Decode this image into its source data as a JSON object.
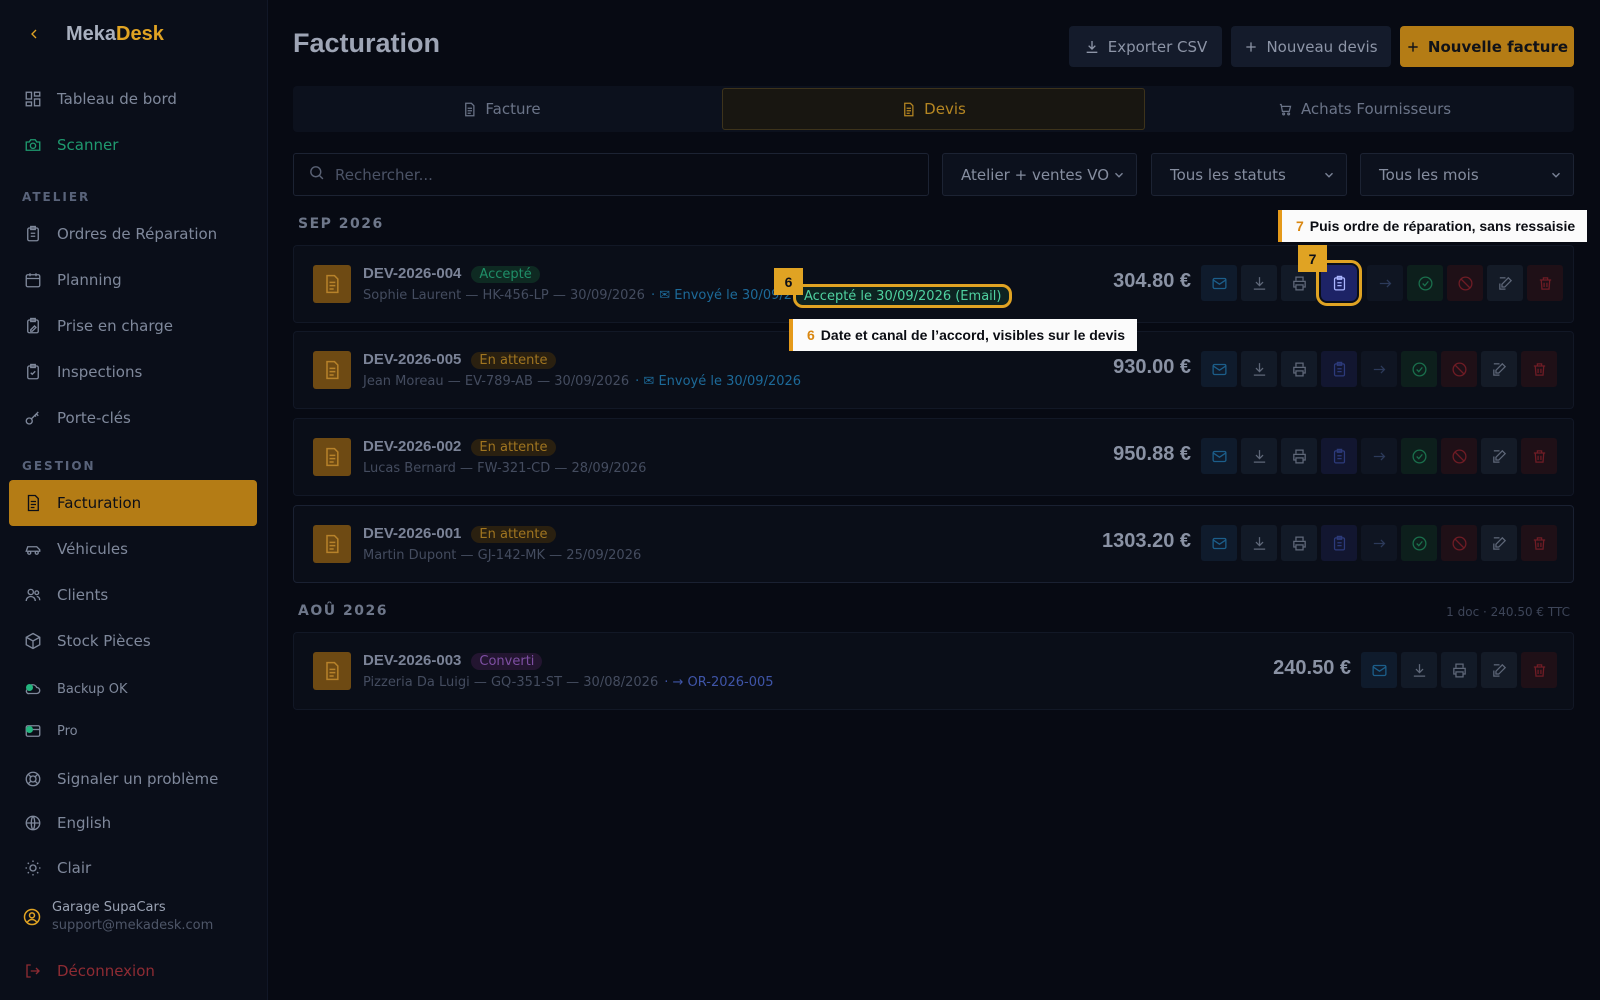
{
  "brand": {
    "part1": "Meka",
    "part2": "Desk"
  },
  "sidebar": {
    "items": [
      {
        "label": "Tableau de bord"
      },
      {
        "label": "Scanner"
      },
      {
        "label": "Ordres de Réparation"
      },
      {
        "label": "Planning"
      },
      {
        "label": "Prise en charge"
      },
      {
        "label": "Inspections"
      },
      {
        "label": "Porte-clés"
      },
      {
        "label": "Facturation"
      },
      {
        "label": "Véhicules"
      },
      {
        "label": "Clients"
      },
      {
        "label": "Stock Pièces"
      },
      {
        "label": "Backup OK"
      },
      {
        "label": "Pro"
      },
      {
        "label": "Signaler un problème"
      },
      {
        "label": "English"
      },
      {
        "label": "Clair"
      }
    ],
    "sections": {
      "atelier": "ATELIER",
      "gestion": "GESTION"
    },
    "user": {
      "name": "Garage SupaCars",
      "email": "support@mekadesk.com"
    },
    "logout": "Déconnexion"
  },
  "page": {
    "title": "Facturation"
  },
  "toolbar": {
    "export": "Exporter CSV",
    "new_quote": "Nouveau devis",
    "new_invoice": "Nouvelle facture"
  },
  "tabs": [
    {
      "label": "Facture"
    },
    {
      "label": "Devis"
    },
    {
      "label": "Achats Fournisseurs"
    }
  ],
  "filters": {
    "search_placeholder": "Rechercher...",
    "scope": "Atelier + ventes VO",
    "status": "Tous les statuts",
    "month": "Tous les mois"
  },
  "groups": {
    "sep": {
      "label": "SEP 2026"
    },
    "aug": {
      "label": "AOÛ 2026",
      "summary": "1 doc · 240.50 € TTC"
    }
  },
  "quotes": [
    {
      "number": "DEV-2026-004",
      "status": "Accepté",
      "meta": "Sophie Laurent — HK-456-LP — 30/09/2026",
      "sent": "Envoyé le 30/09/2026",
      "accepted": "Accepté le 30/09/2026 (Email)",
      "amount": "304.80 €"
    },
    {
      "number": "DEV-2026-005",
      "status": "En attente",
      "meta": "Jean Moreau — EV-789-AB — 30/09/2026",
      "sent": "Envoyé le 30/09/2026",
      "amount": "930.00 €"
    },
    {
      "number": "DEV-2026-002",
      "status": "En attente",
      "meta": "Lucas Bernard — FW-321-CD — 28/09/2026",
      "amount": "950.88 €"
    },
    {
      "number": "DEV-2026-001",
      "status": "En attente",
      "meta": "Martin Dupont — GJ-142-MK — 25/09/2026",
      "amount": "1303.20 €"
    },
    {
      "number": "DEV-2026-003",
      "status": "Converti",
      "meta": "Pizzeria Da Luigi — GQ-351-ST — 30/08/2026",
      "converted": "→ OR-2026-005",
      "amount": "240.50 €"
    }
  ],
  "annotations": {
    "six": {
      "num": "6",
      "text": "Date et canal de l’accord, visibles sur le devis"
    },
    "seven": {
      "num": "7",
      "text": "Puis ordre de réparation, sans ressaisie"
    }
  },
  "colors": {
    "accent": "#e0a323",
    "bg": "#070a13",
    "accepted": "#4fd1a0",
    "info": "#1d6a99"
  }
}
